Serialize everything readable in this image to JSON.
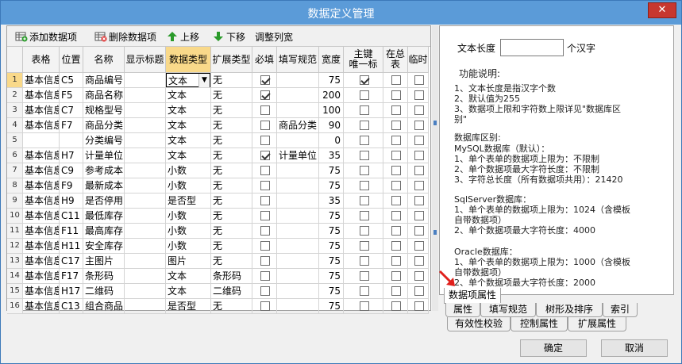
{
  "window": {
    "title": "数据定义管理",
    "close_label": "✕"
  },
  "toolbar": {
    "add_label": "添加数据项",
    "delete_label": "删除数据项",
    "up_label": "上移",
    "down_label": "下移",
    "adjust_label": "调整列宽"
  },
  "grid": {
    "headers": [
      "表格",
      "位置",
      "名称",
      "显示标题",
      "数据类型",
      "扩展类型",
      "必填",
      "填写规范",
      "宽度",
      "主键\n唯一标",
      "在总\n表",
      "临时"
    ],
    "rows": [
      {
        "n": "1",
        "table": "基本信息",
        "pos": "C5",
        "name": "商品编号",
        "title": "",
        "type": "文本",
        "ext": "无",
        "req": true,
        "rule": "",
        "width": "75",
        "pk": true,
        "total": false,
        "temp": false
      },
      {
        "n": "2",
        "table": "基本信息",
        "pos": "F5",
        "name": "商品名称",
        "title": "",
        "type": "文本",
        "ext": "无",
        "req": true,
        "rule": "",
        "width": "200",
        "pk": false,
        "total": false,
        "temp": false
      },
      {
        "n": "3",
        "table": "基本信息",
        "pos": "C7",
        "name": "规格型号",
        "title": "",
        "type": "文本",
        "ext": "无",
        "req": false,
        "rule": "",
        "width": "100",
        "pk": false,
        "total": false,
        "temp": false
      },
      {
        "n": "4",
        "table": "基本信息",
        "pos": "F7",
        "name": "商品分类",
        "title": "",
        "type": "文本",
        "ext": "无",
        "req": false,
        "rule": "商品分类",
        "width": "90",
        "pk": false,
        "total": false,
        "temp": false
      },
      {
        "n": "5",
        "table": "",
        "pos": "",
        "name": "分类编号",
        "title": "",
        "type": "文本",
        "ext": "无",
        "req": false,
        "rule": "",
        "width": "0",
        "pk": false,
        "total": false,
        "temp": false
      },
      {
        "n": "6",
        "table": "基本信息",
        "pos": "H7",
        "name": "计量单位",
        "title": "",
        "type": "文本",
        "ext": "无",
        "req": true,
        "rule": "计量单位",
        "width": "35",
        "pk": false,
        "total": false,
        "temp": false
      },
      {
        "n": "7",
        "table": "基本信息",
        "pos": "C9",
        "name": "参考成本",
        "title": "",
        "type": "小数",
        "ext": "无",
        "req": false,
        "rule": "",
        "width": "75",
        "pk": false,
        "total": false,
        "temp": false
      },
      {
        "n": "8",
        "table": "基本信息",
        "pos": "F9",
        "name": "最新成本",
        "title": "",
        "type": "小数",
        "ext": "无",
        "req": false,
        "rule": "",
        "width": "75",
        "pk": false,
        "total": false,
        "temp": false
      },
      {
        "n": "9",
        "table": "基本信息",
        "pos": "H9",
        "name": "是否停用",
        "title": "",
        "type": "是否型",
        "ext": "无",
        "req": false,
        "rule": "",
        "width": "35",
        "pk": false,
        "total": false,
        "temp": false
      },
      {
        "n": "10",
        "table": "基本信息",
        "pos": "C11",
        "name": "最低库存",
        "title": "",
        "type": "小数",
        "ext": "无",
        "req": false,
        "rule": "",
        "width": "75",
        "pk": false,
        "total": false,
        "temp": false
      },
      {
        "n": "11",
        "table": "基本信息",
        "pos": "F11",
        "name": "最高库存",
        "title": "",
        "type": "小数",
        "ext": "无",
        "req": false,
        "rule": "",
        "width": "75",
        "pk": false,
        "total": false,
        "temp": false
      },
      {
        "n": "12",
        "table": "基本信息",
        "pos": "H11",
        "name": "安全库存",
        "title": "",
        "type": "小数",
        "ext": "无",
        "req": false,
        "rule": "",
        "width": "75",
        "pk": false,
        "total": false,
        "temp": false
      },
      {
        "n": "13",
        "table": "基本信息",
        "pos": "C17",
        "name": "主图片",
        "title": "",
        "type": "图片",
        "ext": "无",
        "req": false,
        "rule": "",
        "width": "75",
        "pk": false,
        "total": false,
        "temp": false
      },
      {
        "n": "14",
        "table": "基本信息",
        "pos": "F17",
        "name": "条形码",
        "title": "",
        "type": "文本",
        "ext": "条形码",
        "req": false,
        "rule": "",
        "width": "75",
        "pk": false,
        "total": false,
        "temp": false
      },
      {
        "n": "15",
        "table": "基本信息",
        "pos": "H17",
        "name": "二维码",
        "title": "",
        "type": "文本",
        "ext": "二维码",
        "req": false,
        "rule": "",
        "width": "75",
        "pk": false,
        "total": false,
        "temp": false
      },
      {
        "n": "16",
        "table": "基本信息",
        "pos": "C13",
        "name": "组合商品",
        "title": "",
        "type": "是否型",
        "ext": "无",
        "req": false,
        "rule": "",
        "width": "75",
        "pk": false,
        "total": false,
        "temp": false
      }
    ]
  },
  "props": {
    "len_label": "文本长度",
    "len_value": "",
    "len_unit": "个汉字",
    "desc_title": "功能说明:",
    "desc_lines": "1、文本长度是指汉字个数\n2、默认值为255\n3、数据项上限和字符数上限详见\"数据库区\n别\"",
    "db_title": "数据库区别:",
    "mysql": "MySQL数据库（默认）：\n1、单个表单的数据项上限为：不限制\n2、单个数据项最大字符长度：不限制\n3、字符总长度（所有数据项共用）：21420",
    "sqlserver": "SqlServer数据库：\n1、单个表单的数据项上限为：1024（含模板\n自带数据项）\n2、单个数据项最大字符长度：4000",
    "oracle": "Oracle数据库：\n1、单个表单的数据项上限为：1000（含模板\n自带数据项）\n2、单个数据项最大字符长度：2000"
  },
  "tabs": {
    "item_attr": "数据项属性",
    "row1": [
      "属性",
      "填写规范",
      "树形及排序",
      "索引"
    ],
    "row2": [
      "有效性校验",
      "控制属性",
      "扩展属性"
    ]
  },
  "buttons": {
    "ok": "确定",
    "cancel": "取消"
  }
}
